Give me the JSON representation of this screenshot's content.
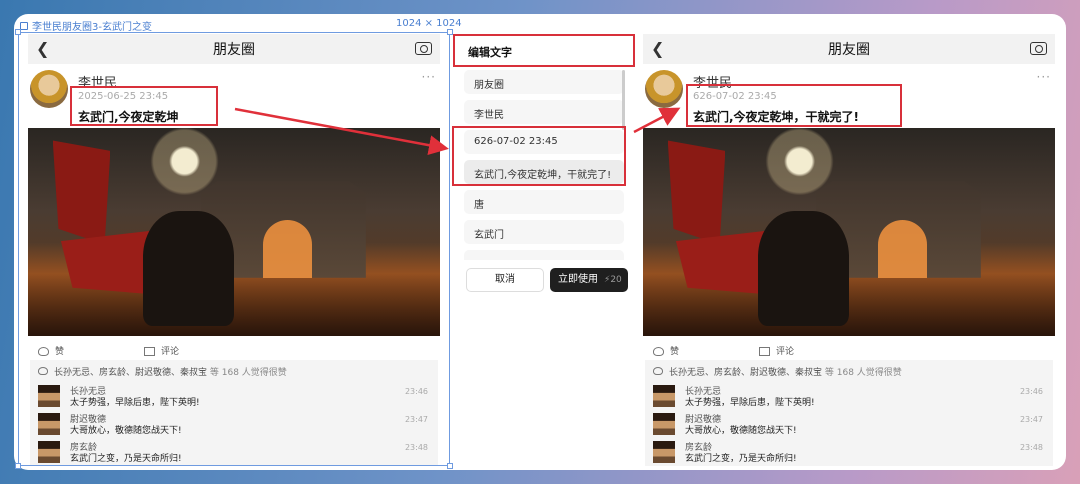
{
  "frame": {
    "label": "李世民朋友圈3-玄武门之变",
    "size": "1024 × 1024"
  },
  "left": {
    "title": "朋友圈",
    "name": "李世民",
    "more": "···",
    "date": "2025-06-25 23:45",
    "text": "玄武门,今夜定乾坤",
    "like": "赞",
    "comment": "评论",
    "likes_names": "长孙无忌、房玄龄、尉迟敬德、秦叔宝",
    "likes_suffix": "等 168 人觉得很赞",
    "comments": [
      {
        "name": "长孙无忌",
        "text": "太子势强，早除后患，陛下英明!",
        "time": "23:46"
      },
      {
        "name": "尉迟敬德",
        "text": "大哥放心，敬德随您战天下!",
        "time": "23:47"
      },
      {
        "name": "房玄龄",
        "text": "玄武门之变，乃是天命所归!",
        "time": "23:48"
      }
    ]
  },
  "right": {
    "title": "朋友圈",
    "name": "李世民",
    "more": "···",
    "date": "626-07-02 23:45",
    "text": "玄武门,今夜定乾坤，干就完了!",
    "like": "赞",
    "comment": "评论",
    "likes_names": "长孙无忌、房玄龄、尉迟敬德、秦叔宝",
    "likes_suffix": "等 168 人觉得很赞",
    "comments": [
      {
        "name": "长孙无忌",
        "text": "太子势强，早除后患，陛下英明!",
        "time": "23:46"
      },
      {
        "name": "尉迟敬德",
        "text": "大哥放心，敬德随您战天下!",
        "time": "23:47"
      },
      {
        "name": "房玄龄",
        "text": "玄武门之变，乃是天命所归!",
        "time": "23:48"
      }
    ]
  },
  "editor": {
    "title": "编辑文字",
    "items": [
      "朋友圈",
      "李世民",
      "626-07-02 23:45",
      "玄武门,今夜定乾坤，干就完了!",
      "唐",
      "玄武门",
      "…"
    ],
    "cancel": "取消",
    "apply": "立即使用",
    "cost": "⚡20"
  },
  "accent": "#d8303a"
}
